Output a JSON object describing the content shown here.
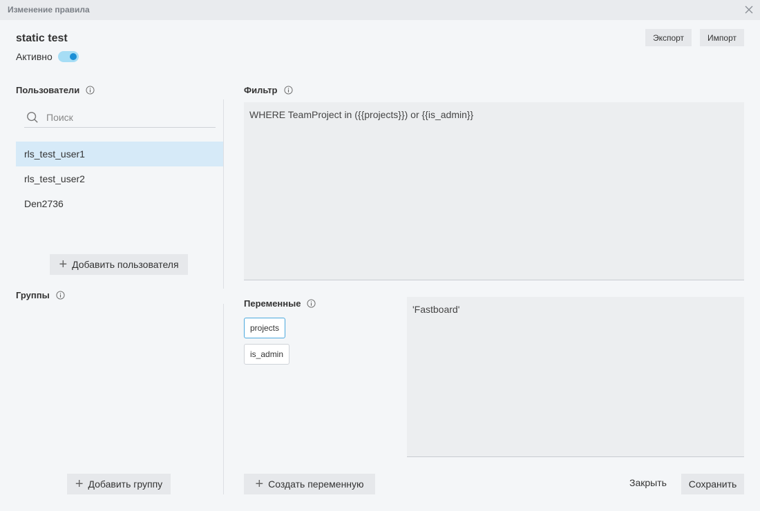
{
  "dialog": {
    "title": "Изменение правила"
  },
  "rule": {
    "name": "static test",
    "active_label": "Активно",
    "active": true
  },
  "toolbar": {
    "export_label": "Экспорт",
    "import_label": "Импорт"
  },
  "users": {
    "title": "Пользователи",
    "search_placeholder": "Поиск",
    "items": [
      {
        "label": "rls_test_user1"
      },
      {
        "label": "rls_test_user2"
      },
      {
        "label": "Den2736"
      }
    ],
    "add_label": "Добавить пользователя"
  },
  "groups": {
    "title": "Группы",
    "add_label": "Добавить группу"
  },
  "filter": {
    "title": "Фильтр",
    "text": "WHERE TeamProject in ({{projects}}) or {{is_admin}}"
  },
  "variables": {
    "title": "Переменные",
    "items": [
      {
        "label": "projects"
      },
      {
        "label": "is_admin"
      }
    ],
    "selected_value": "'Fastboard'",
    "create_label": "Создать переменную"
  },
  "footer": {
    "close_label": "Закрыть",
    "save_label": "Сохранить"
  },
  "colors": {
    "accent": "#1b8fd6",
    "selected_row": "#d6eaf8",
    "toggle_track": "#a6ddf5"
  }
}
